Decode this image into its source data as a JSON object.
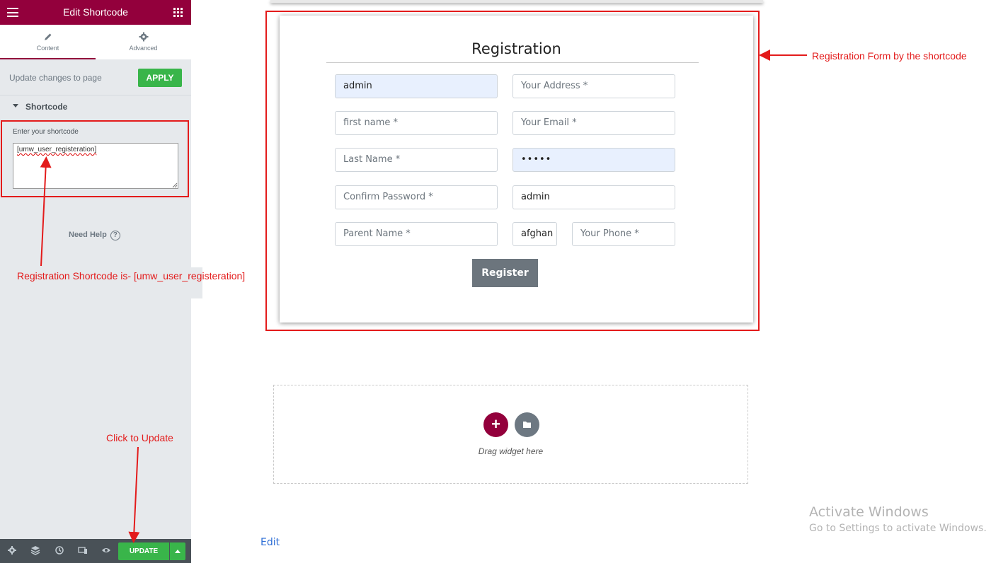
{
  "sidebar": {
    "header_title": "Edit Shortcode",
    "tabs": [
      {
        "label": "Content",
        "icon": "pencil-icon",
        "active": true
      },
      {
        "label": "Advanced",
        "icon": "gear-icon",
        "active": false
      }
    ],
    "apply_text": "Update changes to page",
    "apply_label": "APPLY",
    "section_label": "Shortcode",
    "control_label": "Enter your shortcode",
    "shortcode_value": "[umw_user_registeration]",
    "need_help": "Need Help",
    "footer": {
      "icons": [
        "settings-icon",
        "layers-icon",
        "history-icon",
        "responsive-icon",
        "preview-eye-icon"
      ],
      "update_label": "UPDATE"
    }
  },
  "annotations": {
    "shortcode_note": "Registration Shortcode is- [umw_user_registeration]",
    "update_note": "Click to Update",
    "form_note": "Registration Form by the shortcode"
  },
  "form": {
    "title": "Registration",
    "fields": {
      "username": {
        "value": "admin",
        "placeholder": ""
      },
      "address": {
        "value": "",
        "placeholder": "Your Address *"
      },
      "first_name": {
        "value": "",
        "placeholder": "first name *"
      },
      "email": {
        "value": "",
        "placeholder": "Your Email *"
      },
      "last_name": {
        "value": "",
        "placeholder": "Last Name *"
      },
      "password": {
        "value": "•••••",
        "placeholder": ""
      },
      "confirm_password": {
        "value": "",
        "placeholder": "Confirm Password *"
      },
      "role": {
        "value": "admin",
        "placeholder": ""
      },
      "parent_name": {
        "value": "",
        "placeholder": "Parent Name *"
      },
      "country": {
        "value": "afghan",
        "placeholder": ""
      },
      "phone": {
        "value": "",
        "placeholder": "Your Phone *"
      }
    },
    "register_label": "Register"
  },
  "drop_zone": {
    "text": "Drag widget here"
  },
  "edit_link": "Edit",
  "watermark": {
    "line1": "Activate Windows",
    "line2": "Go to Settings to activate Windows."
  },
  "colors": {
    "brand": "#93003c",
    "apply_green": "#39b54a",
    "annotation_red": "#e31b1b",
    "panel_bg": "#e6e9ec",
    "footer_bg": "#495157",
    "register_btn": "#6c757d",
    "autofill_bg": "#e8f0fe"
  }
}
